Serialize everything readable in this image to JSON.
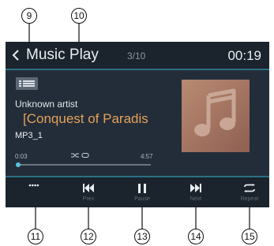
{
  "screen": {
    "header": {
      "title": "Music Play",
      "track_count": "3/10",
      "clock": "00:19"
    },
    "now_playing": {
      "artist": "Unknown artist",
      "song_title": "[Conquest of Paradis",
      "filename": "MP3_1"
    },
    "progress": {
      "elapsed": "0:03",
      "total": "4:57",
      "fraction": 0.01
    },
    "controls": [
      {
        "id": "more",
        "label": "",
        "icon": "more-dots-icon"
      },
      {
        "id": "prev",
        "label": "Prev",
        "icon": "skip-previous-icon"
      },
      {
        "id": "pause",
        "label": "Pause",
        "icon": "pause-icon"
      },
      {
        "id": "next",
        "label": "Next",
        "icon": "skip-next-icon"
      },
      {
        "id": "repeat",
        "label": "Repeat",
        "icon": "repeat-icon"
      }
    ]
  },
  "callouts": [
    "9",
    "10",
    "11",
    "12",
    "13",
    "14",
    "15"
  ],
  "colors": {
    "screen_background": "#232d39",
    "bar_background": "#1b232c",
    "accent_line": "#2a6f86",
    "song_title": "#e3a15a",
    "progress": "#58c2dc",
    "album_art": "#a77764"
  }
}
